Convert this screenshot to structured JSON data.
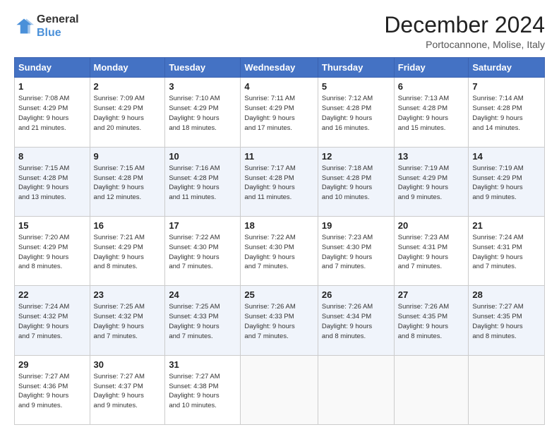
{
  "logo": {
    "line1": "General",
    "line2": "Blue"
  },
  "header": {
    "month": "December 2024",
    "location": "Portocannone, Molise, Italy"
  },
  "weekdays": [
    "Sunday",
    "Monday",
    "Tuesday",
    "Wednesday",
    "Thursday",
    "Friday",
    "Saturday"
  ],
  "weeks": [
    [
      {
        "day": "1",
        "sunrise": "7:08 AM",
        "sunset": "4:29 PM",
        "daylight": "9 hours and 21 minutes."
      },
      {
        "day": "2",
        "sunrise": "7:09 AM",
        "sunset": "4:29 PM",
        "daylight": "9 hours and 20 minutes."
      },
      {
        "day": "3",
        "sunrise": "7:10 AM",
        "sunset": "4:29 PM",
        "daylight": "9 hours and 18 minutes."
      },
      {
        "day": "4",
        "sunrise": "7:11 AM",
        "sunset": "4:29 PM",
        "daylight": "9 hours and 17 minutes."
      },
      {
        "day": "5",
        "sunrise": "7:12 AM",
        "sunset": "4:28 PM",
        "daylight": "9 hours and 16 minutes."
      },
      {
        "day": "6",
        "sunrise": "7:13 AM",
        "sunset": "4:28 PM",
        "daylight": "9 hours and 15 minutes."
      },
      {
        "day": "7",
        "sunrise": "7:14 AM",
        "sunset": "4:28 PM",
        "daylight": "9 hours and 14 minutes."
      }
    ],
    [
      {
        "day": "8",
        "sunrise": "7:15 AM",
        "sunset": "4:28 PM",
        "daylight": "9 hours and 13 minutes."
      },
      {
        "day": "9",
        "sunrise": "7:15 AM",
        "sunset": "4:28 PM",
        "daylight": "9 hours and 12 minutes."
      },
      {
        "day": "10",
        "sunrise": "7:16 AM",
        "sunset": "4:28 PM",
        "daylight": "9 hours and 11 minutes."
      },
      {
        "day": "11",
        "sunrise": "7:17 AM",
        "sunset": "4:28 PM",
        "daylight": "9 hours and 11 minutes."
      },
      {
        "day": "12",
        "sunrise": "7:18 AM",
        "sunset": "4:28 PM",
        "daylight": "9 hours and 10 minutes."
      },
      {
        "day": "13",
        "sunrise": "7:19 AM",
        "sunset": "4:29 PM",
        "daylight": "9 hours and 9 minutes."
      },
      {
        "day": "14",
        "sunrise": "7:19 AM",
        "sunset": "4:29 PM",
        "daylight": "9 hours and 9 minutes."
      }
    ],
    [
      {
        "day": "15",
        "sunrise": "7:20 AM",
        "sunset": "4:29 PM",
        "daylight": "9 hours and 8 minutes."
      },
      {
        "day": "16",
        "sunrise": "7:21 AM",
        "sunset": "4:29 PM",
        "daylight": "9 hours and 8 minutes."
      },
      {
        "day": "17",
        "sunrise": "7:22 AM",
        "sunset": "4:30 PM",
        "daylight": "9 hours and 7 minutes."
      },
      {
        "day": "18",
        "sunrise": "7:22 AM",
        "sunset": "4:30 PM",
        "daylight": "9 hours and 7 minutes."
      },
      {
        "day": "19",
        "sunrise": "7:23 AM",
        "sunset": "4:30 PM",
        "daylight": "9 hours and 7 minutes."
      },
      {
        "day": "20",
        "sunrise": "7:23 AM",
        "sunset": "4:31 PM",
        "daylight": "9 hours and 7 minutes."
      },
      {
        "day": "21",
        "sunrise": "7:24 AM",
        "sunset": "4:31 PM",
        "daylight": "9 hours and 7 minutes."
      }
    ],
    [
      {
        "day": "22",
        "sunrise": "7:24 AM",
        "sunset": "4:32 PM",
        "daylight": "9 hours and 7 minutes."
      },
      {
        "day": "23",
        "sunrise": "7:25 AM",
        "sunset": "4:32 PM",
        "daylight": "9 hours and 7 minutes."
      },
      {
        "day": "24",
        "sunrise": "7:25 AM",
        "sunset": "4:33 PM",
        "daylight": "9 hours and 7 minutes."
      },
      {
        "day": "25",
        "sunrise": "7:26 AM",
        "sunset": "4:33 PM",
        "daylight": "9 hours and 7 minutes."
      },
      {
        "day": "26",
        "sunrise": "7:26 AM",
        "sunset": "4:34 PM",
        "daylight": "9 hours and 8 minutes."
      },
      {
        "day": "27",
        "sunrise": "7:26 AM",
        "sunset": "4:35 PM",
        "daylight": "9 hours and 8 minutes."
      },
      {
        "day": "28",
        "sunrise": "7:27 AM",
        "sunset": "4:35 PM",
        "daylight": "9 hours and 8 minutes."
      }
    ],
    [
      {
        "day": "29",
        "sunrise": "7:27 AM",
        "sunset": "4:36 PM",
        "daylight": "9 hours and 9 minutes."
      },
      {
        "day": "30",
        "sunrise": "7:27 AM",
        "sunset": "4:37 PM",
        "daylight": "9 hours and 9 minutes."
      },
      {
        "day": "31",
        "sunrise": "7:27 AM",
        "sunset": "4:38 PM",
        "daylight": "9 hours and 10 minutes."
      },
      null,
      null,
      null,
      null
    ]
  ],
  "labels": {
    "sunrise": "Sunrise:",
    "sunset": "Sunset:",
    "daylight": "Daylight:"
  }
}
